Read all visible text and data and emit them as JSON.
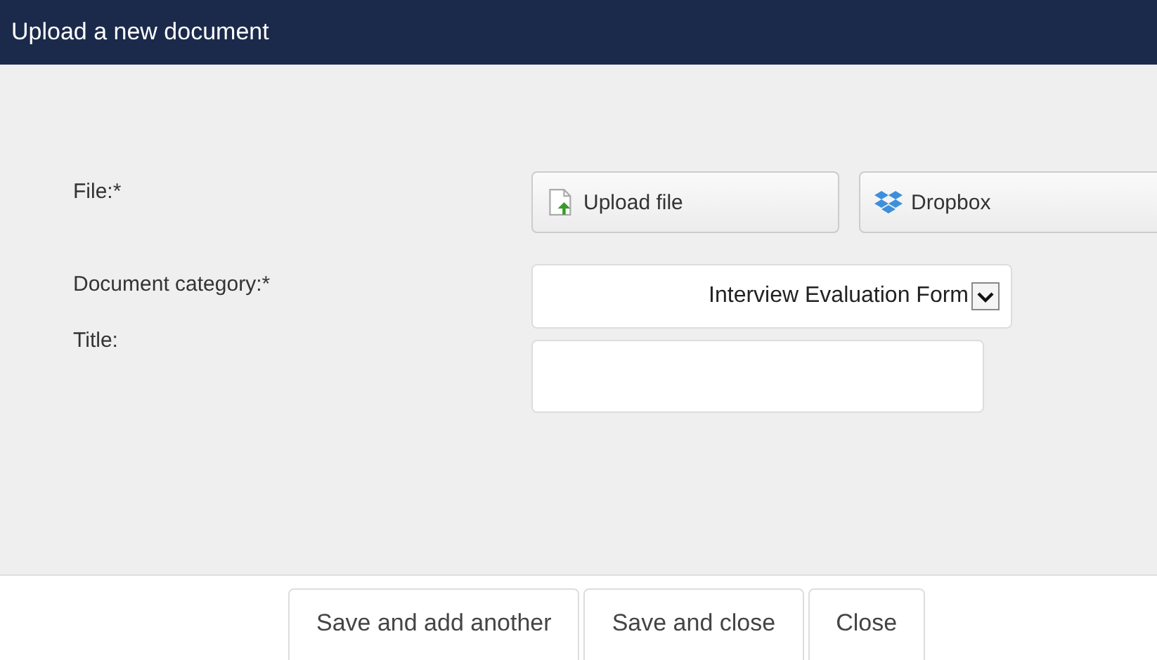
{
  "window": {
    "title": "Upload a new document"
  },
  "form": {
    "file": {
      "label": "File:*",
      "buttons": [
        {
          "kind": "upload",
          "label": "Upload file"
        },
        {
          "kind": "dropbox",
          "label": "Dropbox"
        }
      ]
    },
    "category": {
      "label": "Document category:*",
      "value": "Interview Evaluation Form"
    },
    "title": {
      "label": "Title:"
    }
  },
  "footer_buttons": [
    "Save and add another",
    "Save and close",
    "Close"
  ]
}
